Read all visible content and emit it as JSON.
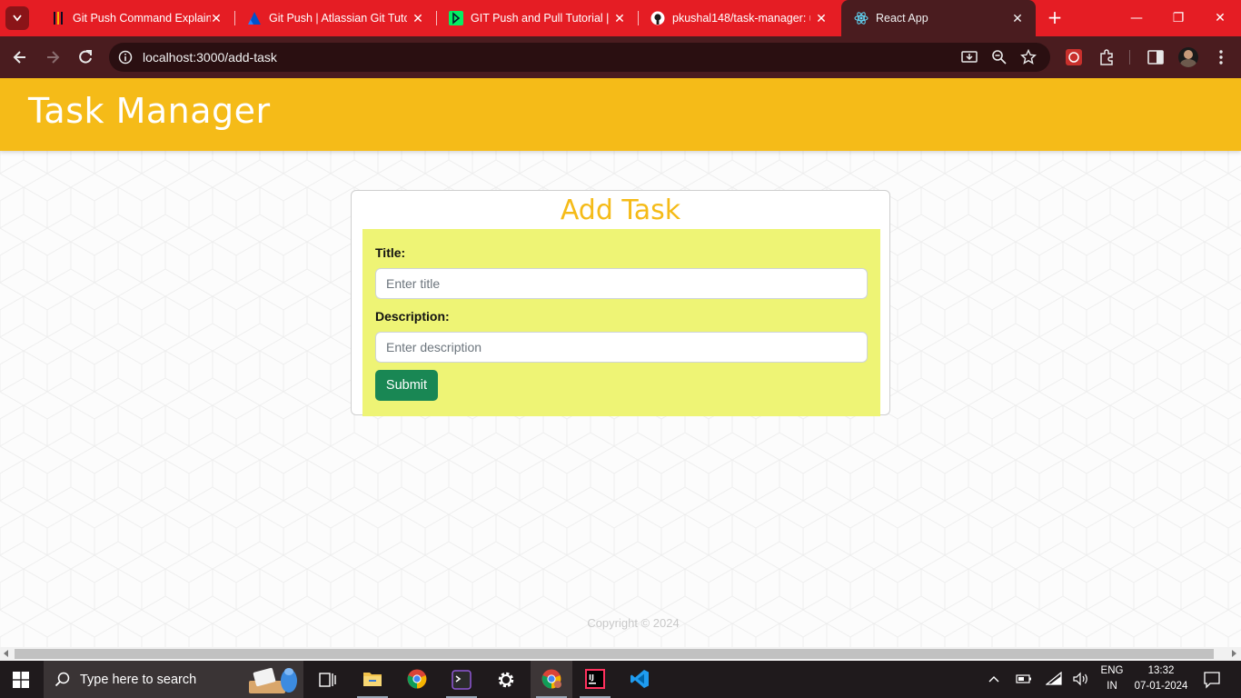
{
  "browser": {
    "tabs": [
      {
        "title": "Git Push Command Explained",
        "icon": "freecodecamp-favicon"
      },
      {
        "title": "Git Push | Atlassian Git Tutorial",
        "icon": "atlassian-favicon"
      },
      {
        "title": "GIT Push and Pull Tutorial | DataCamp",
        "icon": "datacamp-favicon"
      },
      {
        "title": "pkushal148/task-manager: u",
        "icon": "github-favicon"
      },
      {
        "title": "React App",
        "icon": "react-favicon",
        "active": true
      }
    ],
    "url": "localhost:3000/add-task"
  },
  "app": {
    "title": "Task Manager",
    "brand_color": "#f5bb18",
    "form": {
      "heading": "Add Task",
      "title_label": "Title:",
      "title_placeholder": "Enter title",
      "description_label": "Description:",
      "description_placeholder": "Enter description",
      "submit_label": "Submit"
    },
    "footer": "Copyright © 2024"
  },
  "taskbar": {
    "search_placeholder": "Type here to search",
    "language": "ENG",
    "region": "IN",
    "time": "13:32",
    "date": "07-01-2024"
  }
}
